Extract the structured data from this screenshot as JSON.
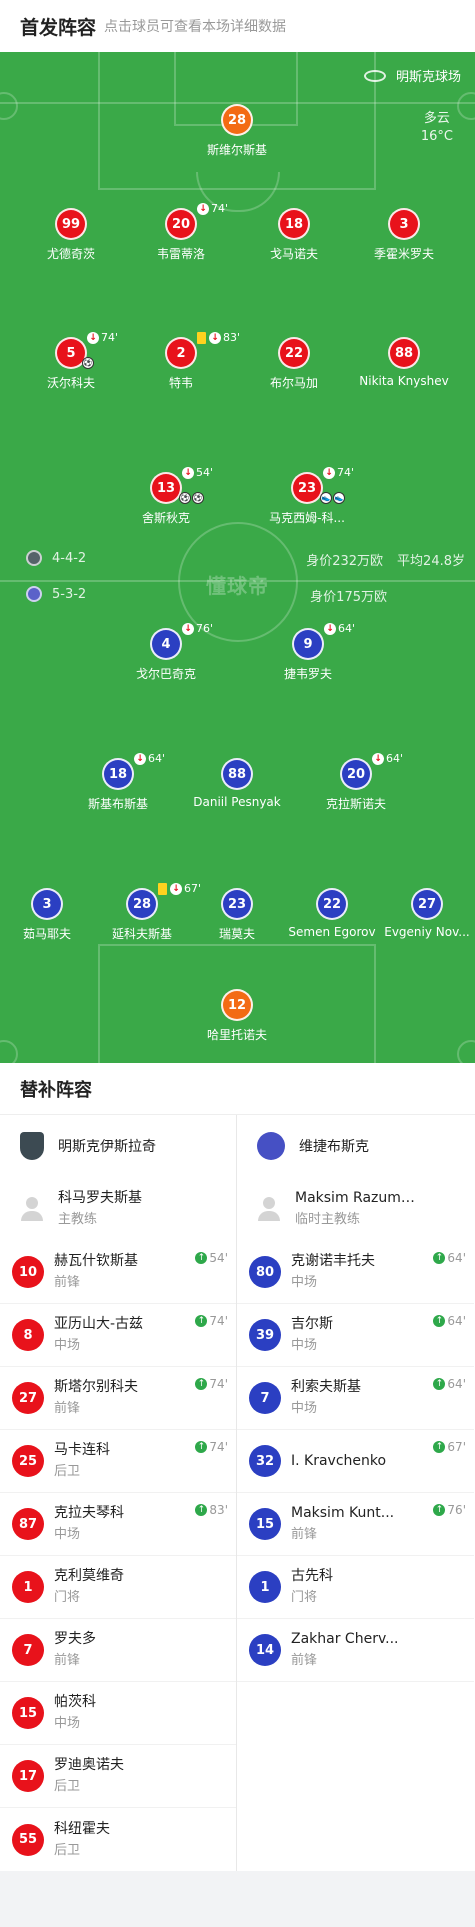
{
  "header": {
    "title": "首发阵容",
    "subtitle": "点击球员可查看本场详细数据"
  },
  "venue": {
    "name": "明斯克球场",
    "weather": "多云",
    "temperature": "16°C"
  },
  "watermark": "懂球帝",
  "home": {
    "formation": "4-4-2",
    "value_label": "身价232万欧",
    "avg_age": "平均24.8岁",
    "players": [
      {
        "num": "28",
        "name": "斯维尔斯基",
        "kit": "orange"
      },
      {
        "num": "99",
        "name": "尤德奇茨",
        "kit": "red"
      },
      {
        "num": "20",
        "name": "韦雷蒂洛",
        "kit": "red",
        "sub": "74'"
      },
      {
        "num": "18",
        "name": "戈马诺夫",
        "kit": "red"
      },
      {
        "num": "3",
        "name": "季霍米罗夫",
        "kit": "red"
      },
      {
        "num": "5",
        "name": "沃尔科夫",
        "kit": "red",
        "sub": "74'"
      },
      {
        "num": "2",
        "name": "特韦",
        "kit": "red",
        "sub": "83'"
      },
      {
        "num": "22",
        "name": "布尔马加",
        "kit": "red"
      },
      {
        "num": "88",
        "name": "Nikita Knyshev",
        "kit": "red"
      },
      {
        "num": "13",
        "name": "舍斯秋克",
        "kit": "red",
        "sub": "54'"
      },
      {
        "num": "23",
        "name": "马克西姆-科...",
        "kit": "red",
        "sub": "74'"
      }
    ]
  },
  "away": {
    "formation": "5-3-2",
    "value_label": "身价175万欧",
    "players": [
      {
        "num": "4",
        "name": "戈尔巴奇克",
        "kit": "blue",
        "sub": "76'"
      },
      {
        "num": "9",
        "name": "捷韦罗夫",
        "kit": "blue",
        "sub": "64'"
      },
      {
        "num": "18",
        "name": "斯基布斯基",
        "kit": "blue",
        "sub": "64'"
      },
      {
        "num": "88",
        "name": "Daniil Pesnyak",
        "kit": "blue"
      },
      {
        "num": "20",
        "name": "克拉斯诺夫",
        "kit": "blue",
        "sub": "64'"
      },
      {
        "num": "3",
        "name": "茹马耶夫",
        "kit": "blue"
      },
      {
        "num": "28",
        "name": "延科夫斯基",
        "kit": "blue",
        "sub": "67'"
      },
      {
        "num": "23",
        "name": "瑞莫夫",
        "kit": "blue"
      },
      {
        "num": "22",
        "name": "Semen Egorov",
        "kit": "blue"
      },
      {
        "num": "27",
        "name": "Evgeniy Nov...",
        "kit": "blue"
      },
      {
        "num": "12",
        "name": "哈里托诺夫",
        "kit": "orange"
      }
    ]
  },
  "subs": {
    "title": "替补阵容",
    "home": {
      "team": "明斯克伊斯拉奇",
      "coach": {
        "name": "科马罗夫斯基",
        "role": "主教练"
      },
      "list": [
        {
          "num": "10",
          "name": "赫瓦什钦斯基",
          "pos": "前锋",
          "in": "54'"
        },
        {
          "num": "8",
          "name": "亚历山大-古兹",
          "pos": "中场",
          "in": "74'"
        },
        {
          "num": "27",
          "name": "斯塔尔别科夫",
          "pos": "前锋",
          "in": "74'"
        },
        {
          "num": "25",
          "name": "马卡连科",
          "pos": "后卫",
          "in": "74'"
        },
        {
          "num": "87",
          "name": "克拉夫琴科",
          "pos": "中场",
          "in": "83'"
        },
        {
          "num": "1",
          "name": "克利莫维奇",
          "pos": "门将",
          "in": ""
        },
        {
          "num": "7",
          "name": "罗夫多",
          "pos": "前锋",
          "in": ""
        },
        {
          "num": "15",
          "name": "帕茨科",
          "pos": "中场",
          "in": ""
        },
        {
          "num": "17",
          "name": "罗迪奥诺夫",
          "pos": "后卫",
          "in": ""
        },
        {
          "num": "55",
          "name": "科纽霍夫",
          "pos": "后卫",
          "in": ""
        }
      ]
    },
    "away": {
      "team": "维捷布斯克",
      "coach": {
        "name": "Maksim Razumov",
        "role": "临时主教练"
      },
      "list": [
        {
          "num": "80",
          "name": "克谢诺丰托夫",
          "pos": "中场",
          "in": "64'"
        },
        {
          "num": "39",
          "name": "吉尔斯",
          "pos": "中场",
          "in": "64'"
        },
        {
          "num": "7",
          "name": "利索夫斯基",
          "pos": "中场",
          "in": "64'"
        },
        {
          "num": "32",
          "name": "I. Kravchenko",
          "pos": "",
          "in": "67'"
        },
        {
          "num": "15",
          "name": "Maksim Kunt...",
          "pos": "前锋",
          "in": "76'"
        },
        {
          "num": "1",
          "name": "古先科",
          "pos": "门将",
          "in": ""
        },
        {
          "num": "14",
          "name": "Zakhar Cherv...",
          "pos": "前锋",
          "in": ""
        }
      ]
    }
  }
}
